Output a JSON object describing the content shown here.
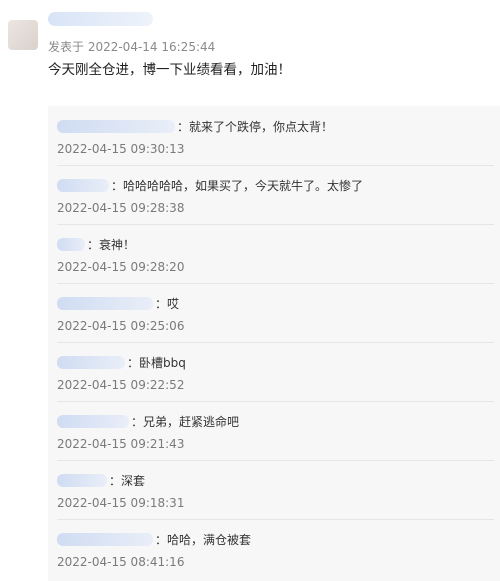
{
  "post": {
    "time": "发表于 2022-04-14 16:25:44",
    "text": "今天刚全仓进，博一下业绩看看，加油！"
  },
  "replies": [
    {
      "text": "：就来了个跌停，你点太背！",
      "time": "2022-04-15 09:30:13"
    },
    {
      "text": "：哈哈哈哈哈，如果买了，今天就牛了。太惨了",
      "time": "2022-04-15 09:28:38"
    },
    {
      "text": "：衰神！",
      "time": "2022-04-15 09:28:20"
    },
    {
      "text": "：哎",
      "time": "2022-04-15 09:25:06"
    },
    {
      "text": "：卧槽bbq",
      "time": "2022-04-15 09:22:52"
    },
    {
      "text": "：兄弟，赶紧逃命吧",
      "time": "2022-04-15 09:21:43"
    },
    {
      "text": "：深套",
      "time": "2022-04-15 09:18:31"
    },
    {
      "text": "：哈哈，满仓被套",
      "time": "2022-04-15 08:41:16"
    }
  ]
}
